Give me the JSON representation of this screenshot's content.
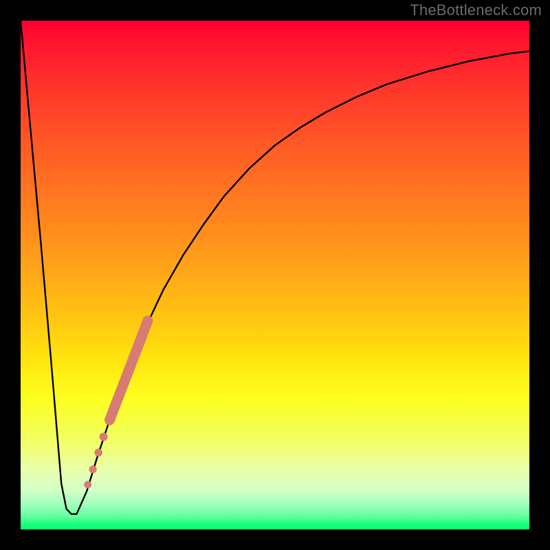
{
  "watermark": "TheBottleneck.com",
  "chart_data": {
    "type": "line",
    "title": "",
    "xlabel": "",
    "ylabel": "",
    "xlim": [
      0,
      100
    ],
    "ylim": [
      0,
      100
    ],
    "grid": false,
    "legend": false,
    "series": [
      {
        "name": "curve",
        "x": [
          0,
          2,
          4,
          6,
          7,
          8,
          9,
          10,
          11,
          13,
          15,
          18,
          21,
          24,
          28,
          32,
          36,
          40,
          45,
          50,
          55,
          60,
          66,
          72,
          80,
          88,
          96,
          100
        ],
        "y": [
          100,
          78,
          56,
          33,
          21,
          9,
          4,
          3,
          3,
          7.5,
          14,
          23,
          31,
          38.5,
          47,
          54,
          60,
          65.5,
          71,
          75.5,
          79,
          82,
          85,
          87.5,
          90,
          92,
          93.5,
          94
        ],
        "style": "solid",
        "color": "#000000",
        "width": 2.4
      }
    ],
    "markers": [
      {
        "name": "segment",
        "type": "capsule",
        "x1": 17.5,
        "y1": 21.5,
        "x2": 25.0,
        "y2": 41.0,
        "width": 15,
        "color": "#d77b73"
      },
      {
        "name": "dot",
        "type": "circle",
        "cx": 16.3,
        "cy": 18.2,
        "r": 6.0,
        "color": "#d77b73"
      },
      {
        "name": "dot",
        "type": "circle",
        "cx": 15.3,
        "cy": 15.1,
        "r": 5.8,
        "color": "#d77b73"
      },
      {
        "name": "dot",
        "type": "circle",
        "cx": 14.2,
        "cy": 11.8,
        "r": 5.6,
        "color": "#d77b73"
      },
      {
        "name": "dot",
        "type": "circle",
        "cx": 13.2,
        "cy": 8.8,
        "r": 5.4,
        "color": "#d77b73"
      }
    ]
  }
}
